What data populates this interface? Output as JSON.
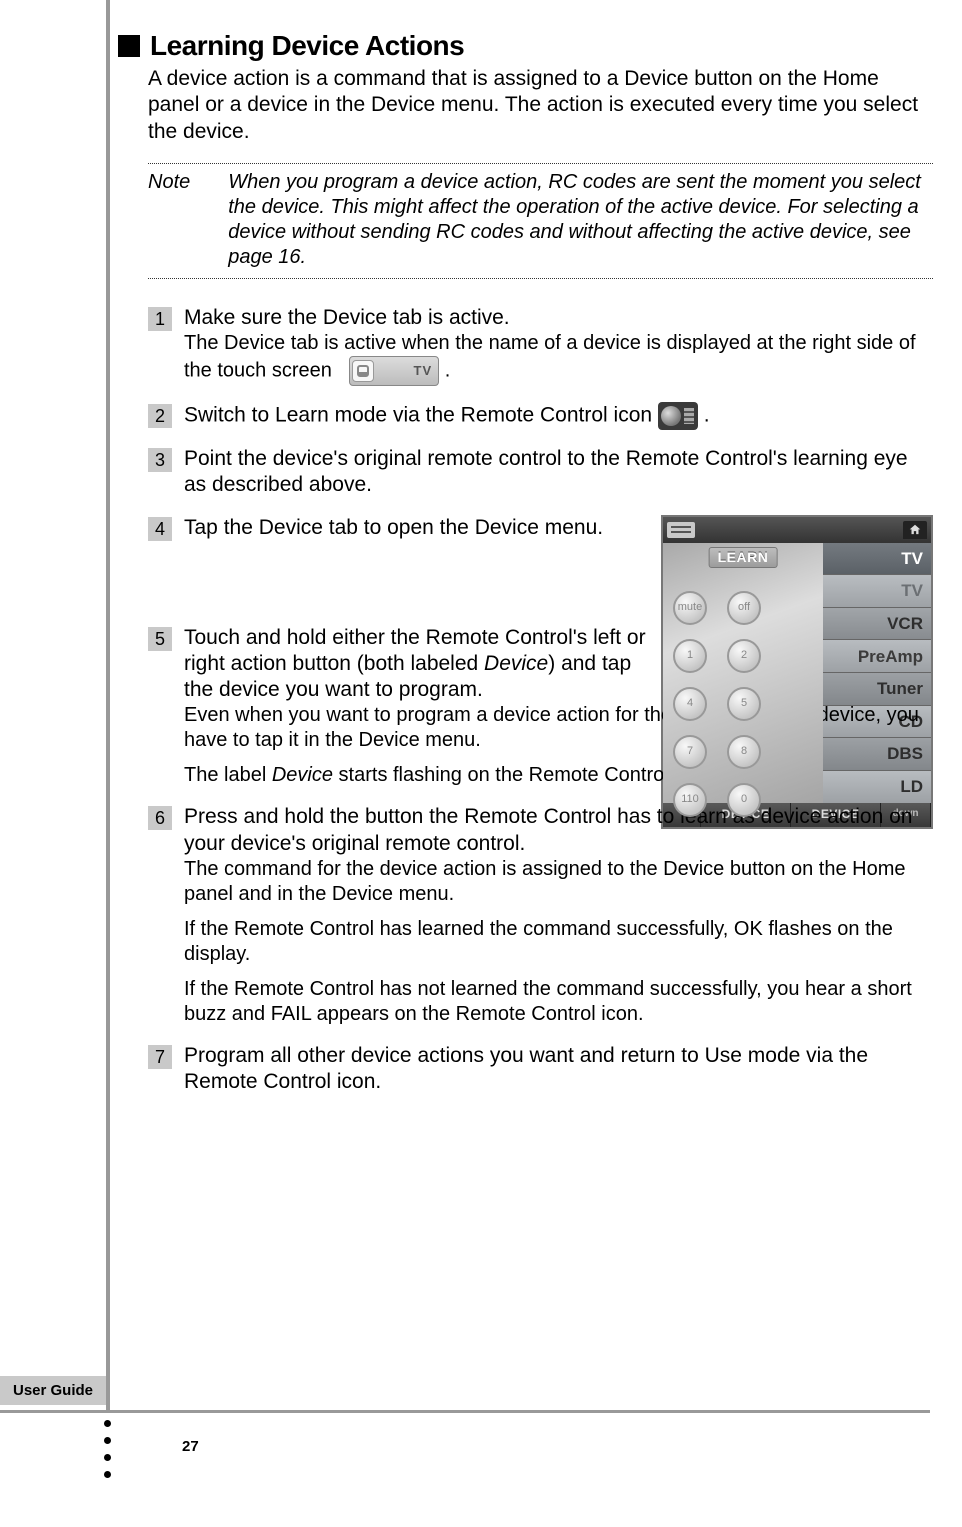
{
  "heading": "Learning Device Actions",
  "intro": "A device action is a command that is assigned to a Device button on the Home panel or a device in the Device menu. The action is executed every time you select the device.",
  "note_label": "Note",
  "note_text": "When you program a device action, RC codes are sent the moment you select the device. This might affect the operation of the active device. For selecting a device without sending RC codes and without affecting the active device, see page 16.",
  "steps": {
    "s1": {
      "num": "1",
      "title": "Make sure the Device tab is active.",
      "sub_a": "The Device tab is active when the name of a device is displayed at the right side of the touch screen",
      "tab_text": "TV",
      "period": "."
    },
    "s2": {
      "num": "2",
      "title_a": "Switch to Learn mode via the Remote Control icon ",
      "period": "."
    },
    "s3": {
      "num": "3",
      "title": "Point the device's original remote control to the Remote Control's learning eye as described above."
    },
    "s4": {
      "num": "4",
      "title": "Tap the Device tab to open the Device menu."
    },
    "s5": {
      "num": "5",
      "title_a": "Touch and hold either the Remote Control's left or right action button (both labeled ",
      "title_em": "Device",
      "title_b": ") and tap the device you want to program.",
      "sub1": "Even when you want to program a device action for the currently active device, you have to tap it in the Device menu.",
      "sub2_a": "The label ",
      "sub2_em": "Device",
      "sub2_b": " starts flashing on the Remote Control icon."
    },
    "s6": {
      "num": "6",
      "title": "Press and hold the button the Remote Control has to learn as device action on your device's original remote control.",
      "sub1": "The command for the device action is assigned to the Device button on the Home panel and in the Device menu.",
      "sub2": "If the Remote Control has learned the command successfully, OK flashes on the display.",
      "sub3": "If the Remote Control has not learned the command successfully, you hear a short buzz and FAIL appears on the Remote Control icon."
    },
    "s7": {
      "num": "7",
      "title": "Program all other device actions you want and return to Use mode via the Remote Control icon."
    }
  },
  "screenshot": {
    "learn": "LEARN",
    "menu": [
      "TV",
      "TV",
      "VCR",
      "PreAmp",
      "Tuner",
      "CD",
      "DBS",
      "LD"
    ],
    "keypad": [
      "mute",
      "off",
      "1",
      "2",
      "4",
      "5",
      "7",
      "8",
      "110",
      "0"
    ],
    "bottom_device": "DEVICE",
    "bottom_down": "down"
  },
  "footer_label": "User Guide",
  "page_number": "27"
}
